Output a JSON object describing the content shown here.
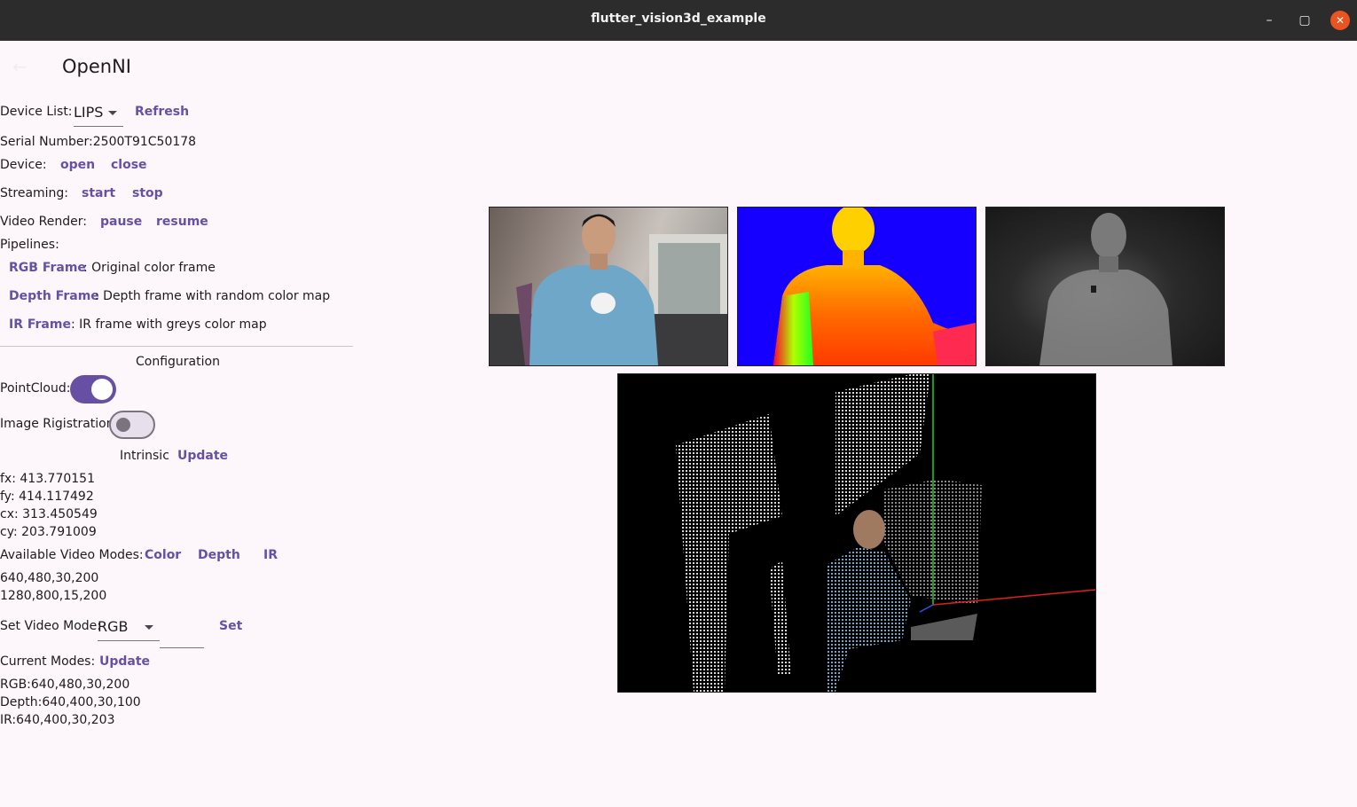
{
  "window": {
    "title": "flutter_vision3d_example",
    "min_icon": "minimize-icon",
    "max_icon": "maximize-icon",
    "close_icon": "close-icon"
  },
  "appbar": {
    "title": "OpenNI",
    "back_icon": "arrow-back-icon"
  },
  "device_list": {
    "label": "Device List:",
    "selected": "LIPS",
    "refresh": "Refresh"
  },
  "serial": "Serial Number:2500T91C50178",
  "device": {
    "label": "Device:",
    "open": "open",
    "close": "close"
  },
  "streaming": {
    "label": "Streaming:",
    "start": "start",
    "stop": "stop"
  },
  "video_render": {
    "label": "Video Render:",
    "pause": "pause",
    "resume": "resume"
  },
  "pipelines": {
    "label": "Pipelines:",
    "items": [
      {
        "button": "RGB Frame",
        "desc": ": Original color frame"
      },
      {
        "button": "Depth Frame",
        "desc": ": Depth frame with random color map"
      },
      {
        "button": "IR Frame",
        "desc": ": IR frame with greys color map"
      }
    ]
  },
  "configuration": {
    "title": "Configuration",
    "pointcloud_label": "PointCloud:",
    "pointcloud_on": true,
    "registration_label": "Image Rigistration",
    "registration_on": false
  },
  "intrinsic": {
    "label": "Intrinsic",
    "update": "Update",
    "fx": "fx:  413.770151",
    "fy": "fy:  414.117492",
    "cx": "cx:  313.450549",
    "cy": "cy:  203.791009"
  },
  "video_modes": {
    "label": "Available Video Modes:",
    "color": "Color",
    "depth": "Depth",
    "ir": "IR",
    "modes": [
      "640,480,30,200",
      "1280,800,15,200"
    ]
  },
  "set_mode": {
    "label": "Set Video Mode:",
    "selected": "RGB",
    "set": "Set"
  },
  "current_modes": {
    "label": "Current Modes:",
    "update": "Update",
    "rgb": "RGB:640,480,30,200",
    "depth": "Depth:640,400,30,100",
    "ir": "IR:640,400,30,203"
  },
  "colors": {
    "accent": "#6750a4",
    "background": "#fdf7fc",
    "titlebar": "#2c2c2c",
    "close": "#e95420"
  }
}
